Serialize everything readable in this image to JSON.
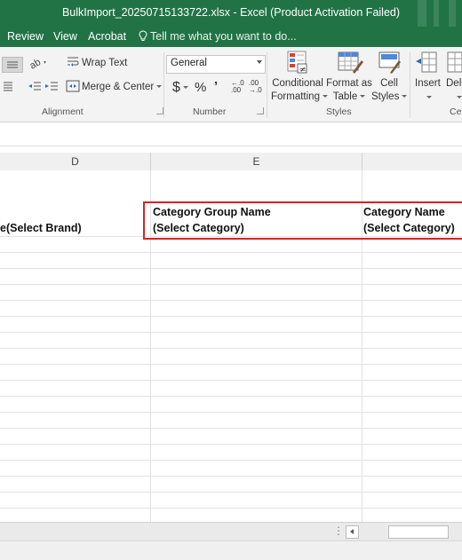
{
  "window": {
    "title": "BulkImport_20250715133722.xlsx - Excel (Product Activation Failed)"
  },
  "menu": {
    "items": [
      "Review",
      "View",
      "Acrobat"
    ],
    "tell_me": "Tell me what you want to do..."
  },
  "ribbon": {
    "alignment": {
      "label": "Alignment",
      "wrap_text": "Wrap Text",
      "merge_center": "Merge & Center"
    },
    "number": {
      "label": "Number",
      "format_value": "General",
      "currency_symbol": "$",
      "percent_symbol": "%",
      "comma_symbol": "’",
      "increase_decimal_top": "←.0",
      "increase_decimal_bottom": ".00",
      "decrease_decimal_top": ".00",
      "decrease_decimal_bottom": "→.0"
    },
    "styles": {
      "label": "Styles",
      "conditional_line1": "Conditional",
      "conditional_line2": "Formatting",
      "format_table_line1": "Format as",
      "format_table_line2": "Table",
      "cell_styles_line1": "Cell",
      "cell_styles_line2": "Styles"
    },
    "cells": {
      "label": "Cel",
      "insert": "Insert",
      "delete": "Dele"
    }
  },
  "columns": [
    "D",
    "E"
  ],
  "cells": {
    "d_header": "e(Select Brand)",
    "e_header_line1": "Category Group Name",
    "e_header_line2": "(Select Category)",
    "f_header_line1": "Category Name",
    "f_header_line2": "(Select Category)"
  },
  "colors": {
    "excel_green": "#217346",
    "highlight_red": "#e01f1f"
  }
}
